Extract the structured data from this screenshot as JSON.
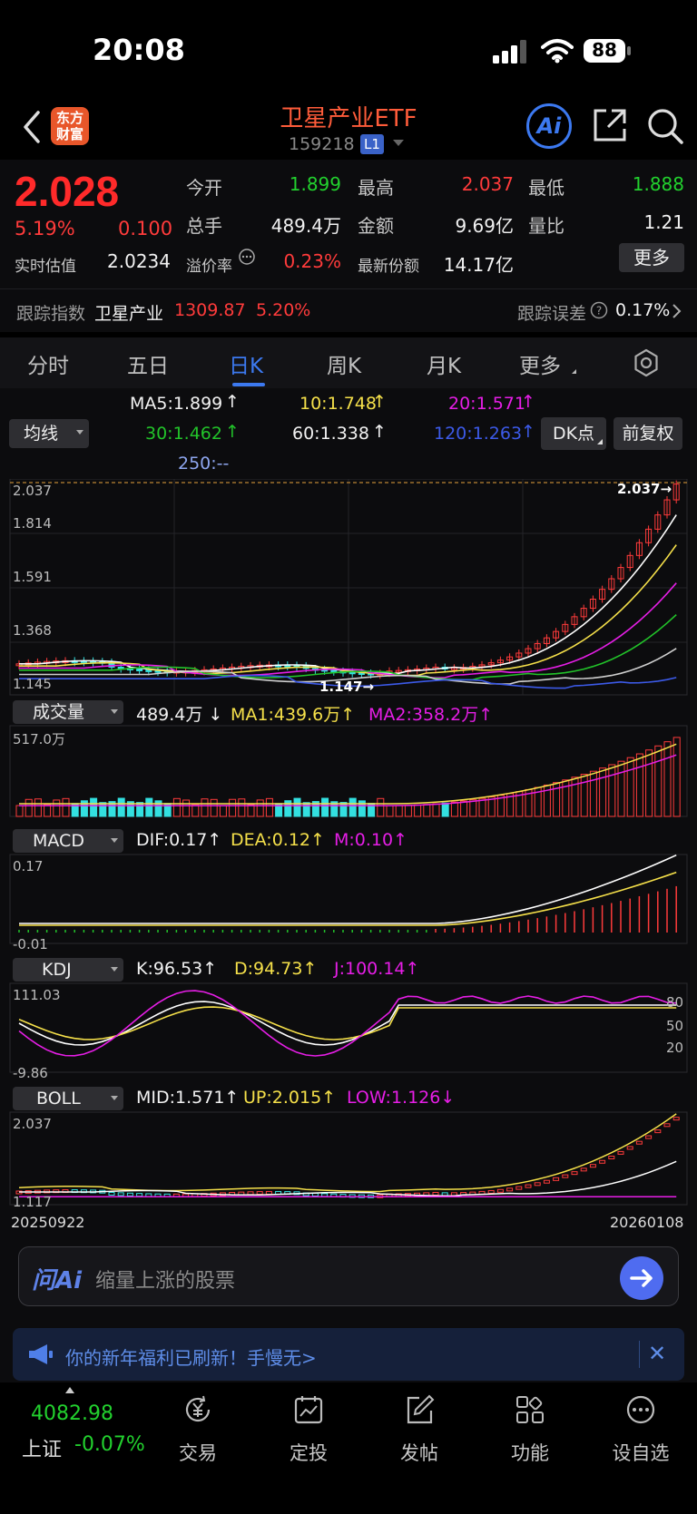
{
  "status_bar": {
    "time": "20:08",
    "battery": "88"
  },
  "header": {
    "title": "卫星产业ETF",
    "code": "159218",
    "level_badge": "L1",
    "logo_top": "东方",
    "logo_bottom": "财富",
    "ai_label": "Ai"
  },
  "quote": {
    "price": "2.028",
    "change_pct": "5.19%",
    "change": "0.100",
    "open_label": "今开",
    "open": "1.899",
    "high_label": "最高",
    "high": "2.037",
    "low_label": "最低",
    "low": "1.888",
    "volume_label": "总手",
    "volume": "489.4万",
    "amount_label": "金额",
    "amount": "9.69亿",
    "ratio_label": "量比",
    "ratio": "1.21",
    "iopv_label": "实时估值",
    "iopv": "2.0234",
    "premium_label": "溢价率",
    "premium": "0.23%",
    "shares_label": "最新份额",
    "shares": "14.17亿",
    "more_label": "更多"
  },
  "tracking": {
    "label": "跟踪指数",
    "index_name": "卫星产业",
    "index_value": "1309.87",
    "index_pct": "5.20%",
    "error_label": "跟踪误差",
    "error_value": "0.17%"
  },
  "tabs": [
    "分时",
    "五日",
    "日K",
    "周K",
    "月K",
    "更多"
  ],
  "active_tab": "日K",
  "ma": {
    "selector": "均线",
    "ma5": "MA5:1.899",
    "ma10": "10:1.748",
    "ma20": "20:1.571",
    "ma30": "30:1.462",
    "ma60": "60:1.338",
    "ma120": "120:1.263",
    "ma250": "250:--",
    "dk_label": "DK点",
    "adjust_label": "前复权"
  },
  "main_chart": {
    "y_labels": [
      "2.037",
      "1.814",
      "1.591",
      "1.368",
      "1.145"
    ],
    "max_label": "2.037",
    "min_label": "1.147"
  },
  "volume_panel": {
    "selector": "成交量",
    "value": "489.4万",
    "ma1": "MA1:439.6万",
    "ma2": "MA2:358.2万",
    "max_label": "517.0万"
  },
  "macd_panel": {
    "selector": "MACD",
    "dif": "DIF:0.17",
    "dea": "DEA:0.12",
    "m": "M:0.10",
    "top_label": "0.17",
    "bottom_label": "-0.01"
  },
  "kdj_panel": {
    "selector": "KDJ",
    "k": "K:96.53",
    "d": "D:94.73",
    "j": "J:100.14",
    "top_label": "111.03",
    "bottom_label": "-9.86",
    "levels": [
      "80",
      "50",
      "20"
    ]
  },
  "boll_panel": {
    "selector": "BOLL",
    "mid": "MID:1.571",
    "up": "UP:2.015",
    "low": "LOW:1.126",
    "top_label": "2.037",
    "bottom_label": "1.117"
  },
  "dates": {
    "start": "20250922",
    "end": "20260108"
  },
  "ask": {
    "logo": "问Ai",
    "placeholder": "缩量上涨的股票"
  },
  "notice": {
    "text": "你的新年福利已刷新！手慢无>"
  },
  "bottom_nav": {
    "index_value": "4082.98",
    "index_name": "上证",
    "index_pct": "-0.07%",
    "items": [
      "交易",
      "定投",
      "发帖",
      "功能",
      "设自选"
    ]
  },
  "colors": {
    "up": "#ff3b3b",
    "down": "#22d12e",
    "accent": "#3c79f0",
    "ma5": "#ffffff",
    "ma10": "#f5e04a",
    "ma20": "#e61ee6",
    "ma30": "#22c32a",
    "ma60": "#cfcfcf",
    "ma120": "#3c5ae8"
  }
}
